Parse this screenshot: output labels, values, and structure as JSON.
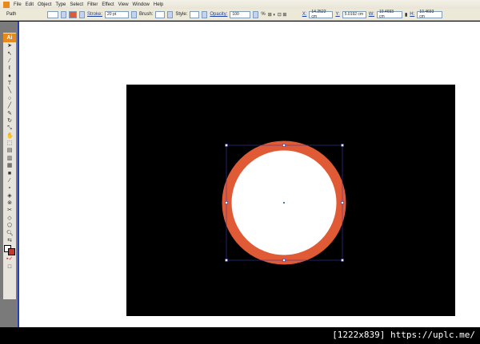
{
  "menu": [
    "File",
    "Edit",
    "Object",
    "Type",
    "Select",
    "Filter",
    "Effect",
    "View",
    "Window",
    "Help"
  ],
  "control": {
    "selection": "Path",
    "stroke_label": "Stroke:",
    "stroke_value": "20 pt",
    "brush_label": "Brush:",
    "style_label": "Style:",
    "opacity_label": "Opacity:",
    "opacity_value": "100",
    "opacity_unit": "%",
    "x_label": "X:",
    "x_value": "14.2522 cm",
    "y_label": "Y:",
    "y_value": "5.0192 cm",
    "w_label": "W:",
    "w_value": "10.4693 cm",
    "h_label": "H:",
    "h_value": "10.4693 cm"
  },
  "toolbar": {
    "logo": "Ai",
    "tools": [
      "selection",
      "direct-selection",
      "magic-wand",
      "lasso",
      "pen",
      "type",
      "line",
      "ellipse",
      "paintbrush",
      "pencil",
      "rotate",
      "scale",
      "warp",
      "free-transform",
      "symbol-sprayer",
      "graph",
      "mesh",
      "gradient",
      "eyedropper",
      "blend",
      "live-paint",
      "live-paint-selection",
      "slice",
      "eraser",
      "scissors",
      "zoom"
    ]
  },
  "colors": {
    "stroke": "#e05a35",
    "fill": "#ffffff",
    "artboard": "#000000",
    "selection": "#3a3aa8"
  },
  "footer": "[1222x839] https://uplc.me/"
}
